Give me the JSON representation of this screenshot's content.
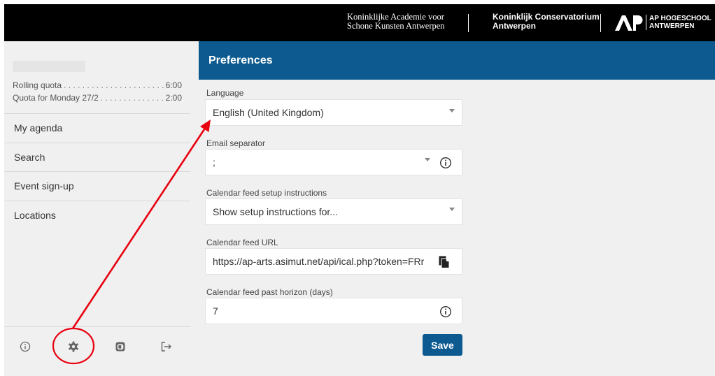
{
  "header": {
    "logo_academie_line1": "Koninklijke Academie voor",
    "logo_academie_line2": "Schone Kunsten Antwerpen",
    "logo_conservatorium_line1": "Koninklijk Conservatorium",
    "logo_conservatorium_line2": "Antwerpen",
    "logo_ap_line1": "AP HOGESCHOOL",
    "logo_ap_line2": "ANTWERPEN"
  },
  "sidebar": {
    "quotas": [
      {
        "label": "Rolling quota",
        "value": "6:00"
      },
      {
        "label": "Quota for Monday 27/2",
        "value": "2:00"
      }
    ],
    "items": [
      {
        "label": "My agenda"
      },
      {
        "label": "Search"
      },
      {
        "label": "Event sign-up"
      },
      {
        "label": "Locations"
      }
    ],
    "bottom_icons": [
      "info-icon",
      "gear-icon",
      "asimut-icon",
      "logout-icon"
    ]
  },
  "preferences": {
    "title": "Preferences",
    "language": {
      "label": "Language",
      "value": "English (United Kingdom)"
    },
    "email_separator": {
      "label": "Email separator",
      "value": ";"
    },
    "calendar_instructions": {
      "label": "Calendar feed setup instructions",
      "value": "Show setup instructions for..."
    },
    "calendar_url": {
      "label": "Calendar feed URL",
      "value": "https://ap-arts.asimut.net/api/ical.php?token=FRr"
    },
    "past_horizon": {
      "label": "Calendar feed past horizon (days)",
      "value": "7"
    },
    "save_label": "Save"
  },
  "colors": {
    "accent": "#0c5a8f",
    "annotation": "#e8000f"
  }
}
